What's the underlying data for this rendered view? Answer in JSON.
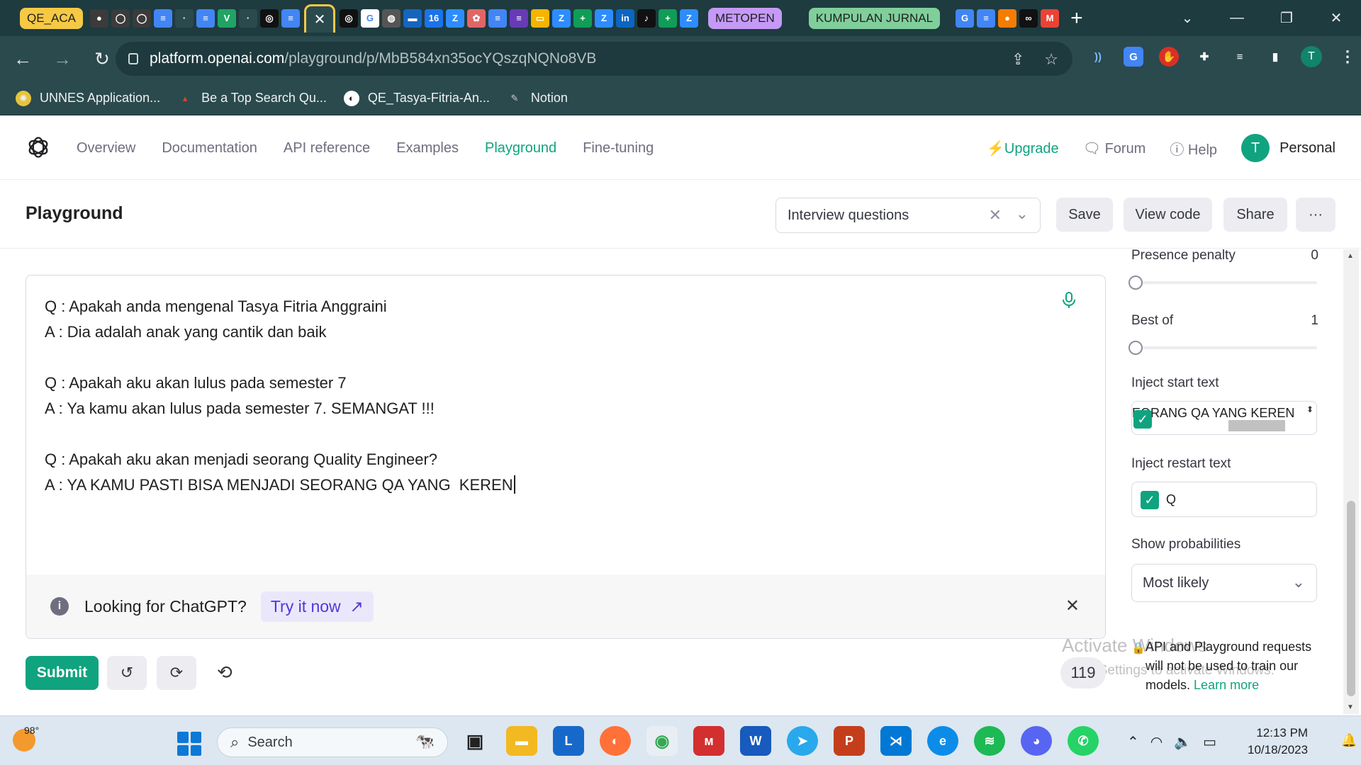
{
  "browser": {
    "tab_groups": [
      "QE_ACA",
      "METOPEN",
      "KUMPULAN JURNAL"
    ],
    "active_tab_icon": "close-icon",
    "url_host": "platform.openai.com",
    "url_path": "/playground/p/MbB584xn35ocYQszqNQNo8VB",
    "profile_initial": "T",
    "bookmarks": [
      "UNNES Application...",
      "Be a Top Search Qu...",
      "QE_Tasya-Fitria-An...",
      "Notion"
    ]
  },
  "nav": {
    "links": [
      "Overview",
      "Documentation",
      "API reference",
      "Examples",
      "Playground",
      "Fine-tuning"
    ],
    "active": "Playground",
    "upgrade": "Upgrade",
    "forum": "Forum",
    "help": "Help",
    "avatar_initial": "T",
    "account": "Personal"
  },
  "header": {
    "title": "Playground",
    "preset_value": "Interview questions",
    "save": "Save",
    "view_code": "View code",
    "share": "Share",
    "more": "···"
  },
  "editor": {
    "lines": [
      "Q : Apakah anda mengenal Tasya Fitria Anggraini",
      "A : Dia adalah anak yang cantik dan baik",
      "",
      "Q : Apakah aku akan lulus pada semester 7",
      "A : Ya kamu akan lulus pada semester 7. SEMANGAT !!!",
      "",
      "Q : Apakah aku akan menjadi seorang Quality Engineer?",
      "A : YA KAMU PASTI BISA MENJADI SEORANG QA YANG  KEREN"
    ],
    "chatgpt_prompt": "Looking for ChatGPT?",
    "try_now": "Try it now"
  },
  "actions": {
    "submit": "Submit",
    "token_count": "119"
  },
  "settings": {
    "presence_penalty_label": "Presence penalty",
    "presence_penalty_value": "0",
    "best_of_label": "Best of",
    "best_of_value": "1",
    "inject_start_label": "Inject start text",
    "inject_start_value": "EORANG QA YANG  KEREN",
    "inject_restart_label": "Inject restart text",
    "inject_restart_value": "Q",
    "show_probabilities_label": "Show probabilities",
    "show_probabilities_value": "Most likely",
    "privacy_text": "API and Playground requests will not be used to train our models.",
    "learn_more": "Learn more"
  },
  "watermark": {
    "line1": "Activate Windows",
    "line2": "Go to Settings to activate Windows."
  },
  "taskbar": {
    "temperature": "98°",
    "search_placeholder": "Search",
    "time": "12:13 PM",
    "date": "10/18/2023"
  },
  "colors": {
    "accent": "#10a37f",
    "chrome_bg": "#2b4a4e"
  }
}
